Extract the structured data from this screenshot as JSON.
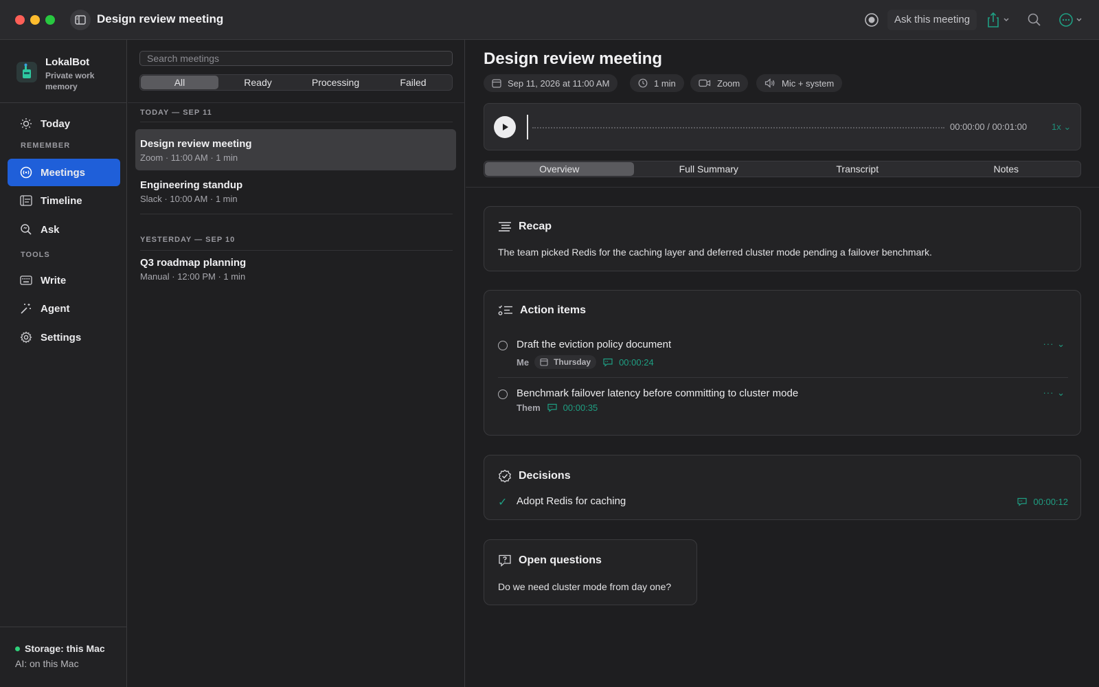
{
  "window": {
    "title": "Design review meeting",
    "ask_label": "Ask this meeting"
  },
  "sidebar": {
    "brand_name": "LokalBot",
    "brand_sub": "Private work memory",
    "today_label": "Today",
    "section_remember": "REMEMBER",
    "section_tools": "TOOLS",
    "items": [
      {
        "label": "Meetings",
        "icon": "meetings-icon",
        "active": true
      },
      {
        "label": "Timeline",
        "icon": "timeline-icon"
      },
      {
        "label": "Ask",
        "icon": "ask-icon"
      },
      {
        "label": "Write",
        "icon": "keyboard-icon"
      },
      {
        "label": "Agent",
        "icon": "agent-icon"
      },
      {
        "label": "Settings",
        "icon": "gear-icon"
      }
    ],
    "storage_label": "Storage: this Mac",
    "ai_label": "AI: on this Mac",
    "storage_dot_color": "#2fd07a"
  },
  "list": {
    "search_placeholder": "Search meetings",
    "filters": [
      "All",
      "Ready",
      "Processing",
      "Failed"
    ],
    "active_filter": "All",
    "groups": [
      {
        "heading": "TODAY — SEP 11",
        "meetings": [
          {
            "title": "Design review meeting",
            "sub": "Zoom · 11:00 AM · 1 min",
            "selected": true
          },
          {
            "title": "Engineering standup",
            "sub": "Slack · 10:00 AM · 1 min"
          }
        ]
      },
      {
        "heading": "YESTERDAY — SEP 10",
        "meetings": [
          {
            "title": "Q3 roadmap planning",
            "sub": "Manual · 12:00 PM · 1 min"
          }
        ]
      }
    ]
  },
  "detail": {
    "title": "Design review meeting",
    "chips": {
      "date": "Sep 11, 2026 at 11:00 AM",
      "duration": "1 min",
      "source": "Zoom",
      "audio": "Mic + system"
    },
    "player": {
      "time": "00:00:00 / 00:01:00",
      "speed": "1x",
      "progress": 0
    },
    "tabs": [
      "Overview",
      "Full Summary",
      "Transcript",
      "Notes"
    ],
    "active_tab": "Overview",
    "recap": {
      "heading": "Recap",
      "text": "The team picked Redis for the caching layer and deferred cluster mode pending a failover benchmark."
    },
    "action_items": {
      "heading": "Action items",
      "items": [
        {
          "text": "Draft the eviction policy document",
          "owner": "Me",
          "due": "Thursday",
          "timestamp": "00:00:24"
        },
        {
          "text": "Benchmark failover latency before committing to cluster mode",
          "owner": "Them",
          "timestamp": "00:00:35"
        }
      ]
    },
    "decisions": {
      "heading": "Decisions",
      "items": [
        {
          "text": "Adopt Redis for caching",
          "timestamp": "00:00:12"
        }
      ]
    },
    "open_questions": {
      "heading": "Open questions",
      "items": [
        "Do we need cluster mode from day one?"
      ]
    },
    "accent_color": "#1f9f83"
  }
}
